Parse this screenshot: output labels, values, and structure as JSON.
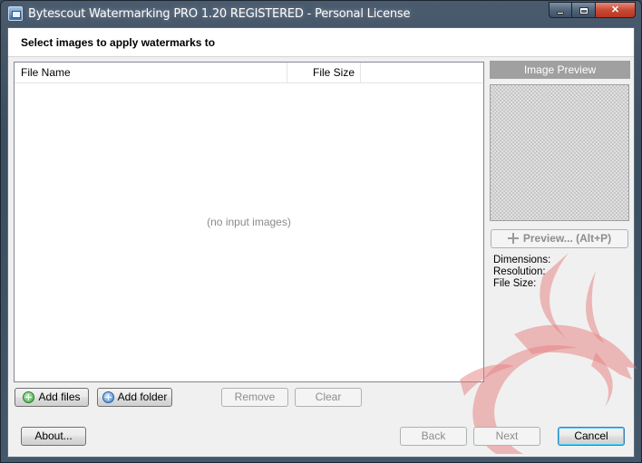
{
  "window": {
    "title": "Bytescout Watermarking PRO 1.20 REGISTERED - Personal License",
    "minimize_icon": "minimize-icon",
    "maximize_icon": "maximize-icon",
    "close_icon": "close-icon",
    "close_glyph": "✕"
  },
  "header": {
    "title": "Select images to apply watermarks to"
  },
  "file_list": {
    "columns": [
      "File Name",
      "File Size"
    ],
    "empty_text": "(no input images)"
  },
  "actions": {
    "add_files": "Add files",
    "add_folder": "Add folder",
    "remove": "Remove",
    "clear": "Clear"
  },
  "preview": {
    "label": "Image Preview",
    "button": "Preview... (Alt+P)",
    "dimensions_label": "Dimensions:",
    "resolution_label": "Resolution:",
    "file_size_label": "File Size:"
  },
  "footer": {
    "about": "About...",
    "back": "Back",
    "next": "Next",
    "cancel": "Cancel"
  },
  "colors": {
    "accent": "#3c7fb1",
    "watermark": "#e57373",
    "titlebar": "#44576b"
  }
}
